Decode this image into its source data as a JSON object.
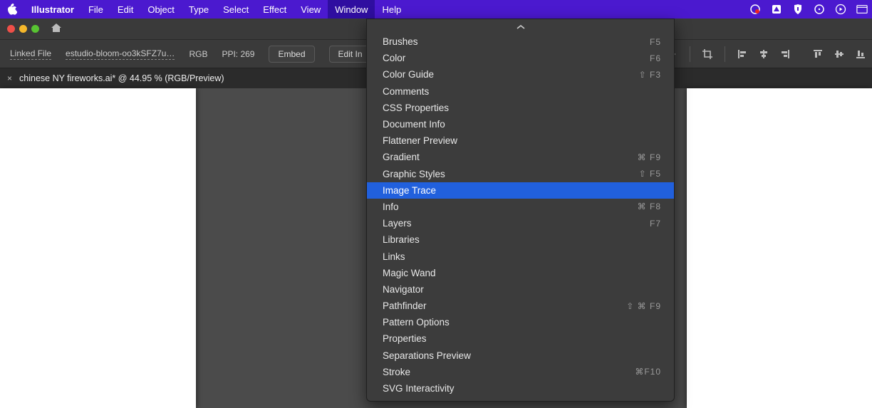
{
  "menubar": {
    "app_name": "Illustrator",
    "items": [
      "File",
      "Edit",
      "Object",
      "Type",
      "Select",
      "Effect",
      "View",
      "Window",
      "Help"
    ],
    "active_index": 7
  },
  "window": {
    "tab_title": "chinese NY fireworks.ai* @ 44.95 % (RGB/Preview)"
  },
  "control_bar": {
    "kind_label": "Linked File",
    "filename": "estudio-bloom-oo3kSFZ7u…",
    "color_mode": "RGB",
    "ppi_label": "PPI: 269",
    "embed_button": "Embed",
    "edit_button": "Edit In"
  },
  "dropdown": {
    "items": [
      {
        "label": "Brushes",
        "shortcut": "F5"
      },
      {
        "label": "Color",
        "shortcut": "F6"
      },
      {
        "label": "Color Guide",
        "shortcut": "⇧ F3"
      },
      {
        "label": "Comments",
        "shortcut": ""
      },
      {
        "label": "CSS Properties",
        "shortcut": ""
      },
      {
        "label": "Document Info",
        "shortcut": ""
      },
      {
        "label": "Flattener Preview",
        "shortcut": ""
      },
      {
        "label": "Gradient",
        "shortcut": "⌘ F9"
      },
      {
        "label": "Graphic Styles",
        "shortcut": "⇧ F5"
      },
      {
        "label": "Image Trace",
        "shortcut": ""
      },
      {
        "label": "Info",
        "shortcut": "⌘ F8"
      },
      {
        "label": "Layers",
        "shortcut": "F7"
      },
      {
        "label": "Libraries",
        "shortcut": ""
      },
      {
        "label": "Links",
        "shortcut": ""
      },
      {
        "label": "Magic Wand",
        "shortcut": ""
      },
      {
        "label": "Navigator",
        "shortcut": ""
      },
      {
        "label": "Pathfinder",
        "shortcut": "⇧ ⌘ F9"
      },
      {
        "label": "Pattern Options",
        "shortcut": ""
      },
      {
        "label": "Properties",
        "shortcut": ""
      },
      {
        "label": "Separations Preview",
        "shortcut": ""
      },
      {
        "label": "Stroke",
        "shortcut": "⌘F10"
      },
      {
        "label": "SVG Interactivity",
        "shortcut": ""
      }
    ],
    "selected_index": 9
  }
}
